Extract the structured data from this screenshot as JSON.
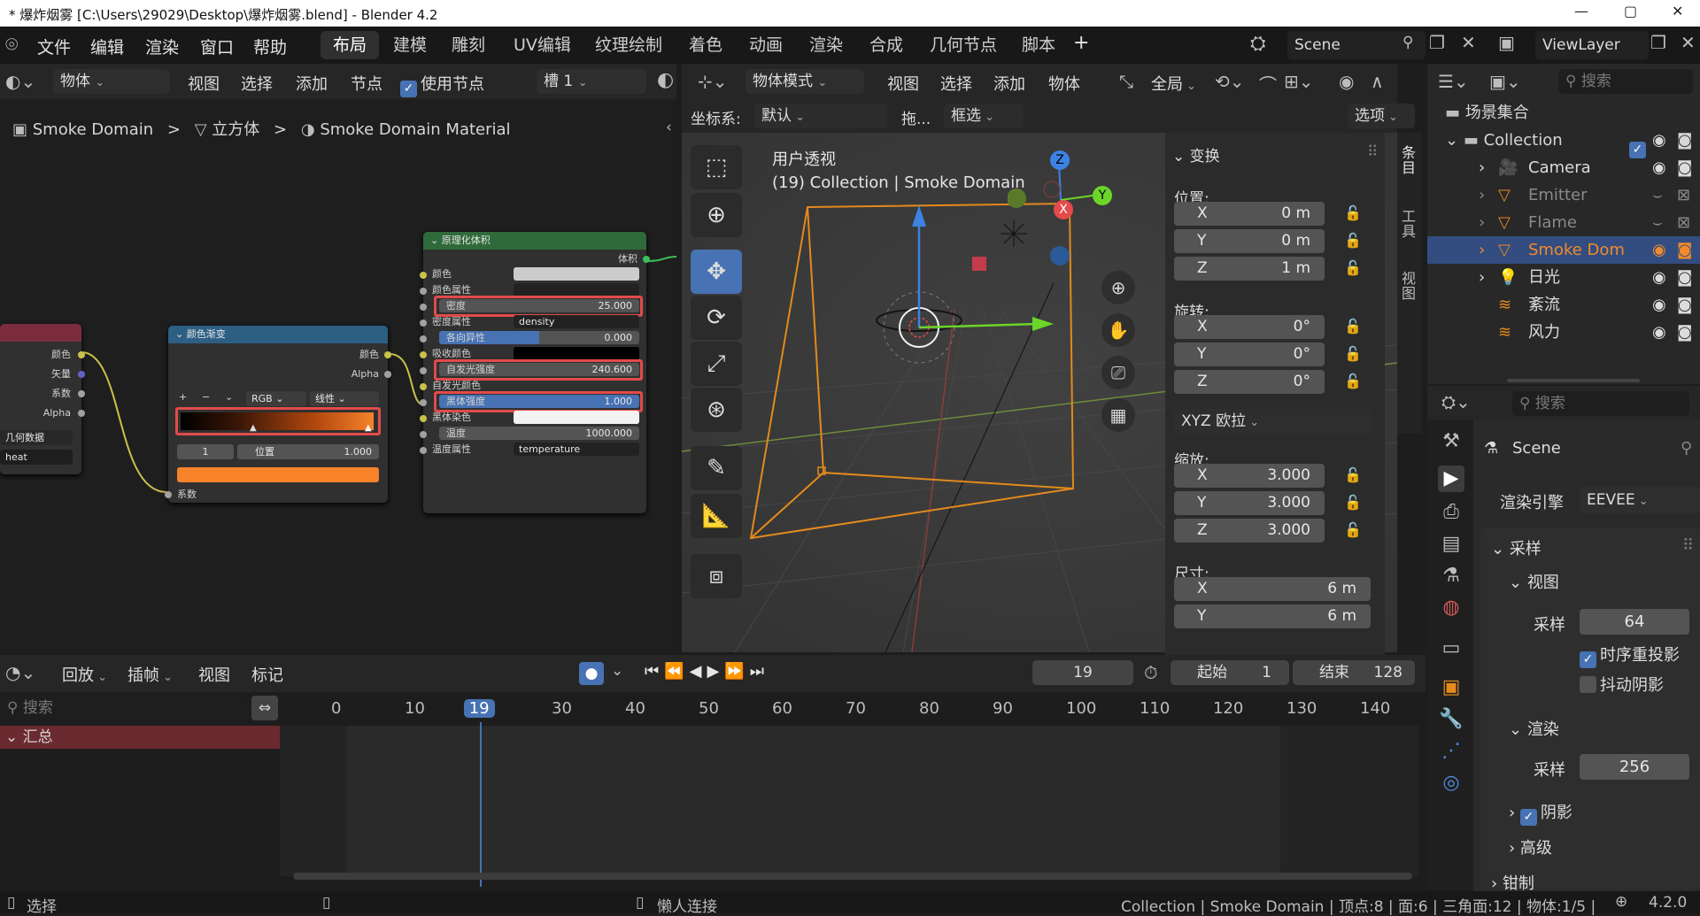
{
  "window": {
    "title": "* 爆炸烟雾 [C:\\Users\\29029\\Desktop\\爆炸烟雾.blend] - Blender 4.2",
    "controls": [
      "—",
      "▢",
      "✕"
    ]
  },
  "menubar": {
    "items": [
      "文件",
      "编辑",
      "渲染",
      "窗口",
      "帮助"
    ],
    "workspaces": [
      "布局",
      "建模",
      "雕刻",
      "UV编辑",
      "纹理绘制",
      "着色",
      "动画",
      "渲染",
      "合成",
      "几何节点",
      "脚本"
    ],
    "active_workspace": "布局",
    "add_tab": "+",
    "scene": "Scene",
    "view_layer": "ViewLayer"
  },
  "node_editor": {
    "mode": "物体",
    "menus": [
      "视图",
      "选择",
      "添加",
      "节点"
    ],
    "use_nodes_label": "使用节点",
    "slot": "槽 1",
    "breadcrumb": [
      "Smoke Domain",
      "立方体",
      "Smoke Domain Material"
    ],
    "sep": ">",
    "left_node": {
      "outputs": [
        "颜色",
        "矢量",
        "系数",
        "Alpha"
      ],
      "dropdown": "几何数据",
      "field": "heat"
    },
    "ramp_node": {
      "title": "颜色渐变",
      "out_color": "颜色",
      "out_alpha": "Alpha",
      "plus": "+",
      "minus": "−",
      "chev": "⌄",
      "mode": "RGB",
      "interp": "线性",
      "index": "1",
      "pos_label": "位置",
      "pos_value": "1.000",
      "in_fac": "系数",
      "active_color": "#f7822a"
    },
    "volume_node": {
      "title": "原理化体积",
      "out": "体积",
      "rows": [
        {
          "label": "颜色",
          "value": ""
        },
        {
          "label": "颜色属性",
          "value": ""
        },
        {
          "label": "密度",
          "value": "25.000"
        },
        {
          "label": "密度属性",
          "value": "density"
        },
        {
          "label": "各向异性",
          "value": "0.000"
        },
        {
          "label": "吸收颜色",
          "value": ""
        },
        {
          "label": "自发光强度",
          "value": "240.600"
        },
        {
          "label": "自发光颜色",
          "value": ""
        },
        {
          "label": "黑体强度",
          "value": "1.000"
        },
        {
          "label": "黑体染色",
          "value": ""
        },
        {
          "label": "温度",
          "value": "1000.000"
        },
        {
          "label": "温度属性",
          "value": "temperature"
        }
      ]
    }
  },
  "viewport": {
    "mode": "物体模式",
    "menus": [
      "视图",
      "选择",
      "添加",
      "物体"
    ],
    "transform_orientation": "全局",
    "coord_label": "坐标系:",
    "coord_value": "默认",
    "drag_label": "拖...",
    "select_mode": "框选",
    "options": "选项",
    "overlay_title": "用户透视",
    "overlay_sub": "(19) Collection | Smoke Domain",
    "gizmo": {
      "z": "Z",
      "y": "Y",
      "x": "X"
    },
    "side_tabs": [
      "条目",
      "工具",
      "视图"
    ]
  },
  "npanel": {
    "section": "变换",
    "location_label": "位置:",
    "location": [
      {
        "k": "X",
        "v": "0 m"
      },
      {
        "k": "Y",
        "v": "0 m"
      },
      {
        "k": "Z",
        "v": "1 m"
      }
    ],
    "rotation_label": "旋转:",
    "rotation": [
      {
        "k": "X",
        "v": "0°"
      },
      {
        "k": "Y",
        "v": "0°"
      },
      {
        "k": "Z",
        "v": "0°"
      }
    ],
    "rotation_mode": "XYZ 欧拉",
    "scale_label": "缩放:",
    "scale": [
      {
        "k": "X",
        "v": "3.000"
      },
      {
        "k": "Y",
        "v": "3.000"
      },
      {
        "k": "Z",
        "v": "3.000"
      }
    ],
    "dims_label": "尺寸:",
    "dims": [
      {
        "k": "X",
        "v": "6 m"
      },
      {
        "k": "Y",
        "v": "6 m"
      }
    ]
  },
  "outliner": {
    "search_placeholder": "搜索",
    "root": "场景集合",
    "collection": "Collection",
    "items": [
      {
        "name": "Camera",
        "dim": false,
        "selected": false
      },
      {
        "name": "Emitter",
        "dim": true,
        "selected": false
      },
      {
        "name": "Flame",
        "dim": true,
        "selected": false
      },
      {
        "name": "Smoke Dom",
        "dim": false,
        "selected": true
      },
      {
        "name": "日光",
        "dim": false,
        "selected": false
      },
      {
        "name": "紊流",
        "dim": false,
        "selected": false
      },
      {
        "name": "风力",
        "dim": false,
        "selected": false
      }
    ]
  },
  "properties": {
    "search_placeholder": "搜索",
    "scene": "Scene",
    "render_engine_label": "渲染引擎",
    "render_engine": "EEVEE",
    "sampling": "采样",
    "viewport": "视图",
    "samples_label": "采样",
    "viewport_samples": "64",
    "temporal_reproj": "时序重投影",
    "jitter_shadows": "抖动阴影",
    "render": "渲染",
    "render_samples": "256",
    "shadows": "阴影",
    "advanced": "高级",
    "clamp": "钳制"
  },
  "timeline": {
    "menus": [
      "回放",
      "插帧",
      "视图",
      "标记"
    ],
    "current_frame": "19",
    "start_label": "起始",
    "start": "1",
    "end_label": "结束",
    "end": "128",
    "search_placeholder": "搜索",
    "summary": "汇总",
    "ruler": [
      "0",
      "10",
      "19",
      "30",
      "40",
      "50",
      "60",
      "70",
      "80",
      "90",
      "100",
      "110",
      "120",
      "130",
      "140"
    ]
  },
  "statusbar": {
    "select": "选择",
    "lazy_connect": "懒人连接",
    "stats": "Collection | Smoke Domain | 顶点:8 | 面:6 | 三角面:12 | 物体:1/5 |",
    "version": "4.2.0"
  }
}
